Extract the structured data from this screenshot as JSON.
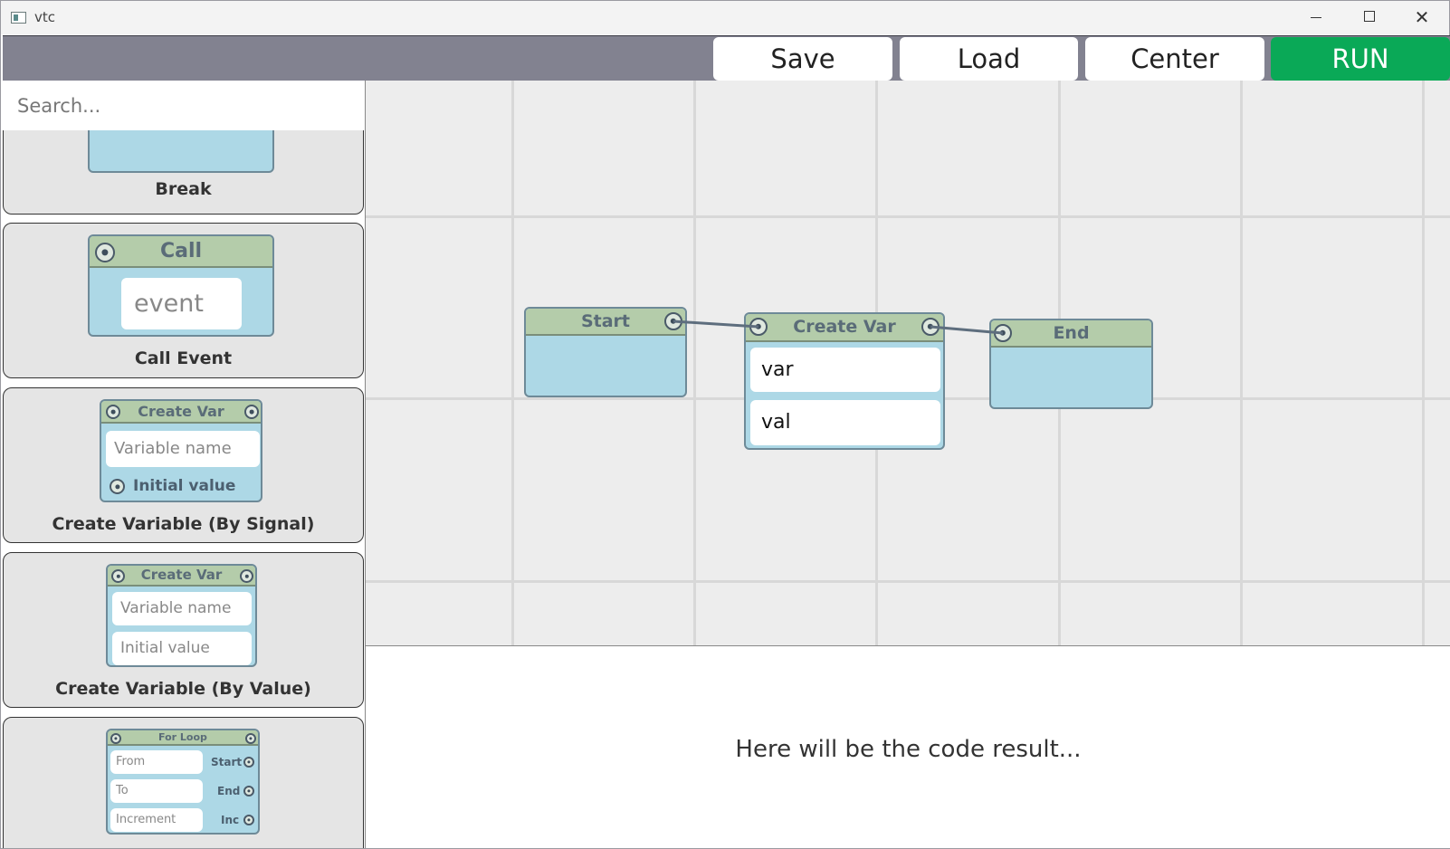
{
  "window": {
    "title": "vtc"
  },
  "toolbar": {
    "save_label": "Save",
    "load_label": "Load",
    "center_label": "Center",
    "run_label": "RUN",
    "run_color": "#0aa957"
  },
  "sidebar": {
    "search_placeholder": "Search...",
    "cards": {
      "break": {
        "label": "Break"
      },
      "call_event": {
        "label": "Call Event",
        "node_title": "Call",
        "field": "event"
      },
      "create_var_signal": {
        "label": "Create Variable (By Signal)",
        "node_title": "Create Var",
        "name_placeholder": "Variable name",
        "value_label": "Initial value"
      },
      "create_var_value": {
        "label": "Create Variable (By Value)",
        "node_title": "Create Var",
        "name_placeholder": "Variable name",
        "value_placeholder": "Initial value"
      },
      "for_loop": {
        "node_title": "For Loop",
        "from_placeholder": "From",
        "to_placeholder": "To",
        "inc_placeholder": "Increment",
        "start_label": "Start",
        "end_label": "End",
        "inc_label": "Inc"
      }
    }
  },
  "canvas": {
    "nodes": {
      "start": {
        "title": "Start"
      },
      "create_var": {
        "title": "Create Var",
        "var_value": "var",
        "val_value": "val"
      },
      "end": {
        "title": "End"
      }
    },
    "wire_color": "#5e6e7e"
  },
  "output": {
    "placeholder": "Here will be the code result..."
  }
}
